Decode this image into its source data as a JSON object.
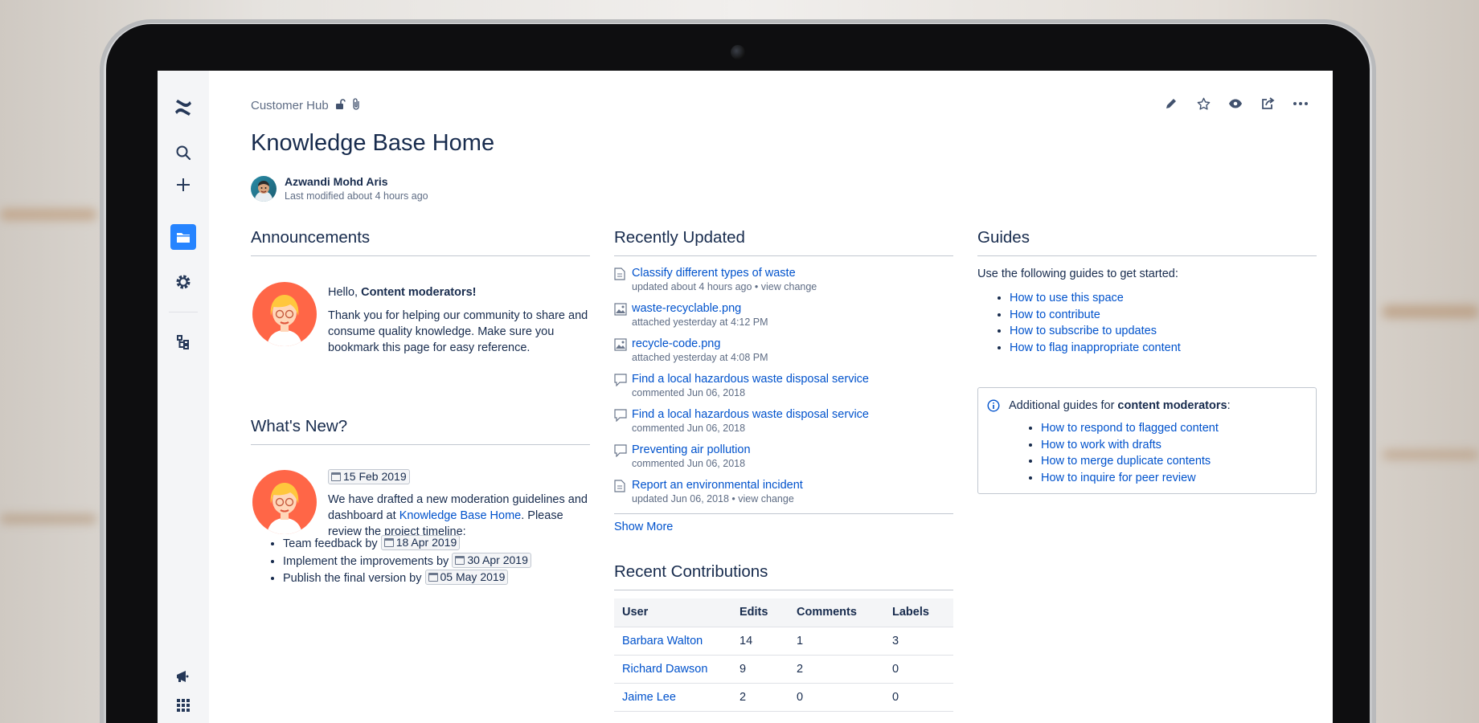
{
  "space": {
    "name": "Customer Hub",
    "lock_icon": "unlock-icon",
    "attach_icon": "paperclip-icon"
  },
  "page": {
    "title": "Knowledge Base Home",
    "author": "Azwandi Mohd Aris",
    "modified": "Last modified about 4 hours ago"
  },
  "sidebar": {
    "items": [
      {
        "icon": "confluence-logo-icon"
      },
      {
        "icon": "search-icon"
      },
      {
        "icon": "create-plus-icon"
      },
      {
        "icon": "space-folder-icon"
      },
      {
        "icon": "gear-icon"
      },
      {
        "icon": "page-tree-icon"
      },
      {
        "icon": "notifications-megaphone-icon"
      },
      {
        "icon": "app-switcher-grid-icon"
      }
    ],
    "active_color": "#2684ff"
  },
  "toolbar": {
    "icons": [
      "edit-pencil-icon",
      "star-icon",
      "watch-eye-icon",
      "share-icon",
      "more-ellipsis-icon"
    ]
  },
  "announcements": {
    "heading": "Announcements",
    "greeting_prefix": "Hello, ",
    "greeting_bold": "Content moderators!",
    "body": "Thank you for helping our community to share and consume quality knowledge. Make sure you bookmark this page for easy reference."
  },
  "whats_new": {
    "heading": "What's New?",
    "date": "15 Feb 2019",
    "body_before_link": "We have drafted a new moderation guidelines and dashboard at ",
    "link_text": "Knowledge Base Home",
    "body_after_link": ". Please review the project timeline:",
    "items": [
      {
        "text": "Team feedback by ",
        "date": "18 Apr 2019"
      },
      {
        "text": "Implement the improvements by ",
        "date": "30 Apr 2019"
      },
      {
        "text": "Publish the final version by ",
        "date": "05 May 2019"
      }
    ]
  },
  "recently_updated": {
    "heading": "Recently Updated",
    "items": [
      {
        "icon": "page-icon",
        "title": "Classify different types of waste",
        "meta": "updated about 4 hours ago",
        "extra": "view change"
      },
      {
        "icon": "image-icon",
        "title": "waste-recyclable.png",
        "meta": "attached yesterday at 4:12 PM",
        "extra": ""
      },
      {
        "icon": "image-icon",
        "title": "recycle-code.png",
        "meta": "attached yesterday at 4:08 PM",
        "extra": ""
      },
      {
        "icon": "comment-icon",
        "title": "Find a local hazardous waste disposal service",
        "meta": "commented Jun 06, 2018",
        "extra": ""
      },
      {
        "icon": "comment-icon",
        "title": "Find a local hazardous waste disposal service",
        "meta": "commented Jun 06, 2018",
        "extra": ""
      },
      {
        "icon": "comment-icon",
        "title": "Preventing air pollution",
        "meta": "commented Jun 06, 2018",
        "extra": ""
      },
      {
        "icon": "page-icon",
        "title": "Report an environmental incident",
        "meta": "updated Jun 06, 2018",
        "extra": "view change"
      }
    ],
    "show_more": "Show More"
  },
  "recent_contributions": {
    "heading": "Recent Contributions",
    "columns": [
      "User",
      "Edits",
      "Comments",
      "Labels"
    ],
    "rows": [
      {
        "user": "Barbara Walton",
        "edits": "14",
        "comments": "1",
        "labels": "3"
      },
      {
        "user": "Richard Dawson",
        "edits": "9",
        "comments": "2",
        "labels": "0"
      },
      {
        "user": "Jaime Lee",
        "edits": "2",
        "comments": "0",
        "labels": "0"
      }
    ]
  },
  "guides": {
    "heading": "Guides",
    "intro": "Use the following guides to get started:",
    "links": [
      "How to use this space",
      "How to contribute",
      "How to subscribe to updates",
      "How to flag inappropriate content"
    ],
    "info_prefix": "Additional guides for ",
    "info_bold": "content moderators",
    "info_suffix": ":",
    "info_links": [
      "How to respond to flagged content",
      "How to work with drafts",
      "How to merge duplicate contents",
      "How to inquire for peer review"
    ]
  }
}
